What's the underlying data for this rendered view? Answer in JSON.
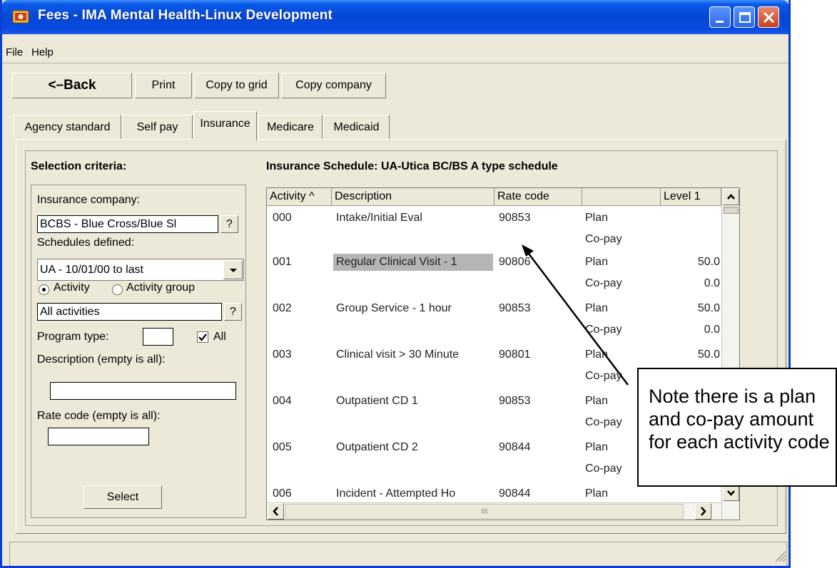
{
  "window": {
    "title": "Fees - IMA Mental Health-Linux Development"
  },
  "menu": {
    "items": [
      "File",
      "Help"
    ]
  },
  "toolbar": {
    "back": "<–Back",
    "print": "Print",
    "copy_to_grid": "Copy to grid",
    "copy_company": "Copy company"
  },
  "tabs": [
    "Agency standard",
    "Self pay",
    "Insurance",
    "Medicare",
    "Medicaid"
  ],
  "active_tab": "Insurance",
  "selection": {
    "title": "Selection criteria:",
    "insurance_company_label": "Insurance company:",
    "insurance_company_value": "BCBS - Blue Cross/Blue Sl",
    "lookup_button": "?",
    "schedules_label": "Schedules defined:",
    "schedule_value": "UA - 10/01/00 to last",
    "radio_activity": "Activity",
    "radio_activity_group": "Activity group",
    "activity_filter_value": "All activities",
    "program_type_label": "Program type:",
    "all_label": "All",
    "description_label": "Description (empty is all):",
    "rate_code_label": "Rate code (empty is all):",
    "select_button": "Select"
  },
  "schedule": {
    "title": "Insurance Schedule: UA-Utica BC/BS A type schedule",
    "columns": [
      "Activity ^",
      "Description",
      "Rate code",
      "",
      "Level 1"
    ],
    "rows": [
      {
        "activity": "000",
        "description": "Intake/Initial Eval",
        "rate_code": "90853",
        "plan": "Plan",
        "plan_level": "",
        "copay": "Co-pay",
        "copay_level": ""
      },
      {
        "activity": "001",
        "description": "Regular Clinical Visit - 1",
        "rate_code": "90806",
        "plan": "Plan",
        "plan_level": "50.0",
        "copay": "Co-pay",
        "copay_level": "0.0"
      },
      {
        "activity": "002",
        "description": "Group Service - 1 hour",
        "rate_code": "90853",
        "plan": "Plan",
        "plan_level": "50.0",
        "copay": "Co-pay",
        "copay_level": "0.0"
      },
      {
        "activity": "003",
        "description": "Clinical visit > 30 Minute",
        "rate_code": "90801",
        "plan": "Plan",
        "plan_level": "50.0",
        "copay": "Co-pay",
        "copay_level": ""
      },
      {
        "activity": "004",
        "description": "Outpatient CD 1",
        "rate_code": "90853",
        "plan": "Plan",
        "plan_level": "",
        "copay": "Co-pay",
        "copay_level": ""
      },
      {
        "activity": "005",
        "description": "Outpatient CD 2",
        "rate_code": "90844",
        "plan": "Plan",
        "plan_level": "",
        "copay": "Co-pay",
        "copay_level": ""
      },
      {
        "activity": "006",
        "description": "Incident - Attempted Ho",
        "rate_code": "90844",
        "plan": "Plan",
        "plan_level": ""
      }
    ],
    "hscroll_grip": "III"
  },
  "callout": {
    "text": "Note there is a plan and co-pay amount for each activity code"
  },
  "colors": {
    "title_bar": "#0a4be0",
    "face": "#ece9d8",
    "highlight": "#b5b5b5"
  }
}
